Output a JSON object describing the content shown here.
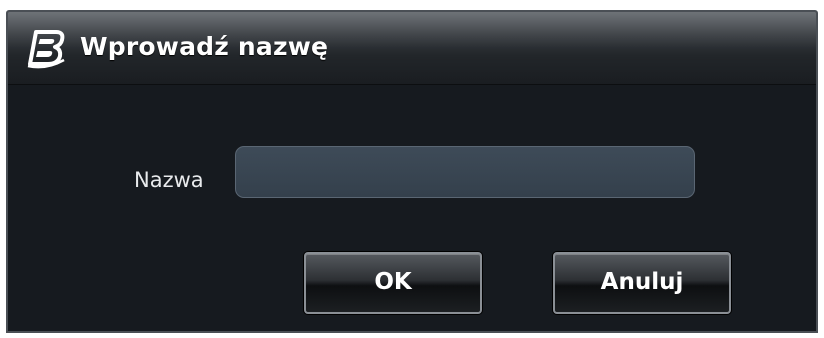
{
  "dialog": {
    "title": "Wprowadź nazwę",
    "logo_icon": "b-logo-icon"
  },
  "form": {
    "name_label": "Nazwa",
    "name_value": "",
    "name_placeholder": ""
  },
  "buttons": {
    "ok_label": "OK",
    "cancel_label": "Anuluj"
  },
  "colors": {
    "background": "#161a1f",
    "input_fill": "#3a4652",
    "text": "#ffffff"
  }
}
